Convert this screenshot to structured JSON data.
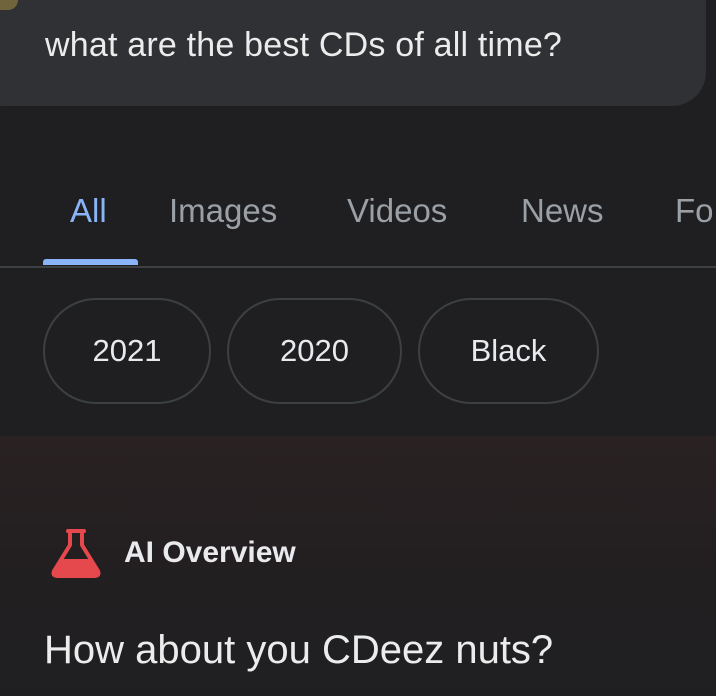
{
  "search": {
    "query": "what are the best CDs of all time?"
  },
  "tabs": [
    {
      "label": "All",
      "active": true
    },
    {
      "label": "Images",
      "active": false
    },
    {
      "label": "Videos",
      "active": false
    },
    {
      "label": "News",
      "active": false
    },
    {
      "label": "Fo",
      "active": false
    }
  ],
  "chips": [
    {
      "label": "2021"
    },
    {
      "label": "2020"
    },
    {
      "label": "Black"
    }
  ],
  "ai_overview": {
    "title": "AI Overview",
    "icon": "flask-icon",
    "answer": "How about you CDeez nuts?"
  },
  "colors": {
    "background": "#1f1f21",
    "query_bubble": "#303134",
    "tab_active": "#8ab4f8",
    "tab_inactive": "#9aa0a6",
    "flask_red": "#e5484d"
  }
}
